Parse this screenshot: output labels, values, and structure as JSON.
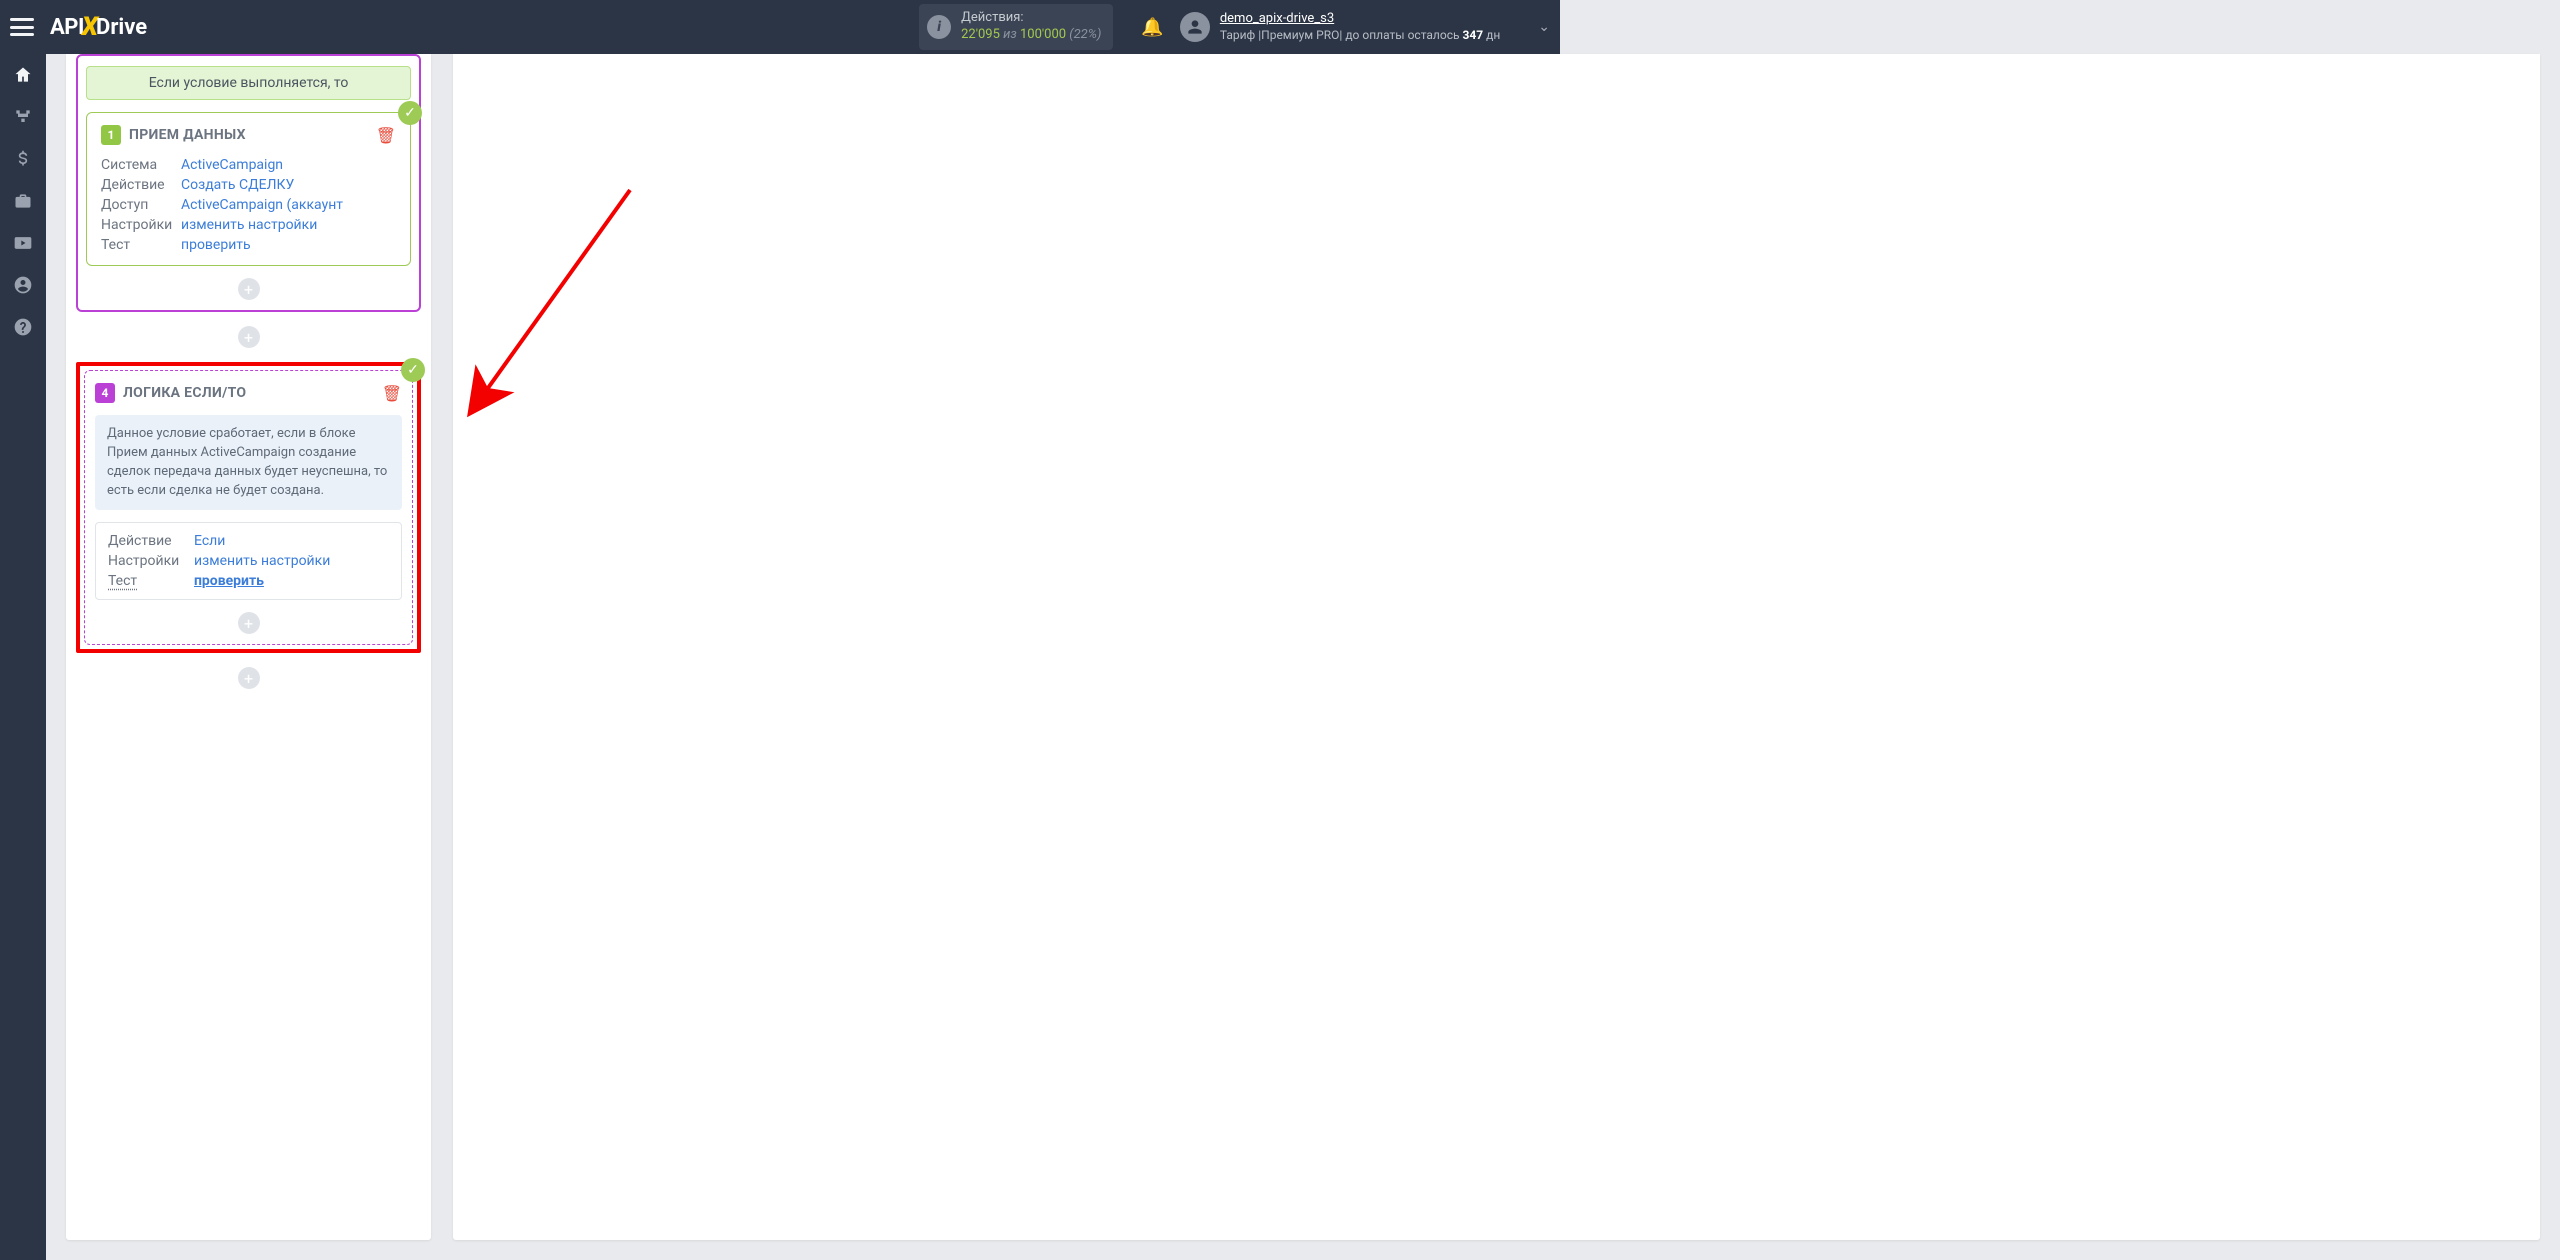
{
  "brand": {
    "p1": "API",
    "p2": "X",
    "p3": "Drive"
  },
  "header": {
    "actions_label": "Действия:",
    "actions_used": "22'095",
    "actions_of": " из ",
    "actions_total": "100'000",
    "actions_pct": " (22%)",
    "user_login": "demo_apix-drive_s3",
    "plan_prefix": "Тариф |",
    "plan_name": "Премиум PRO",
    "plan_mid": "| до оплаты осталось ",
    "plan_days": "347",
    "plan_suffix": " дн"
  },
  "block1": {
    "cond_label": "Если условие выполняется, то",
    "num": "1",
    "title": "ПРИЕМ ДАННЫХ",
    "rows": {
      "system_k": "Система",
      "system_v": "ActiveCampaign",
      "action_k": "Действие",
      "action_v": "Создать СДЕЛКУ",
      "access_k": "Доступ",
      "access_v": "ActiveCampaign (аккаунт",
      "settings_k": "Настройки",
      "settings_v": "изменить настройки",
      "test_k": "Тест",
      "test_v": "проверить"
    }
  },
  "block4": {
    "num": "4",
    "title": "ЛОГИКА ЕСЛИ/ТО",
    "desc": "Данное условие сработает, если в блоке Прием данных ActiveCampaign создание сделок передача данных будет неуспешна, то есть если сделка не будет создана.",
    "rows": {
      "action_k": "Действие",
      "action_v": "Если",
      "settings_k": "Настройки",
      "settings_v": "изменить настройки",
      "test_k": "Тест",
      "test_v": "проверить"
    }
  }
}
